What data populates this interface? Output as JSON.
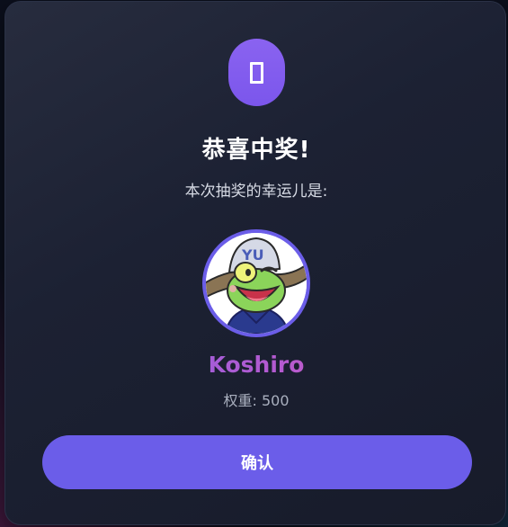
{
  "modal": {
    "icon": "trophy-icon",
    "title": "恭喜中奖!",
    "subtitle": "本次抽奖的幸运儿是:",
    "winner": {
      "avatar": "frog-avatar",
      "name": "Koshiro",
      "weight": "权重: 500"
    },
    "confirm_label": "确认"
  },
  "colors": {
    "accent": "#6b5de9",
    "badge": "#8a63f0",
    "name_gradient_start": "#7a63ea",
    "name_gradient_end": "#e466a6",
    "modal_bg": "#1c2133"
  }
}
